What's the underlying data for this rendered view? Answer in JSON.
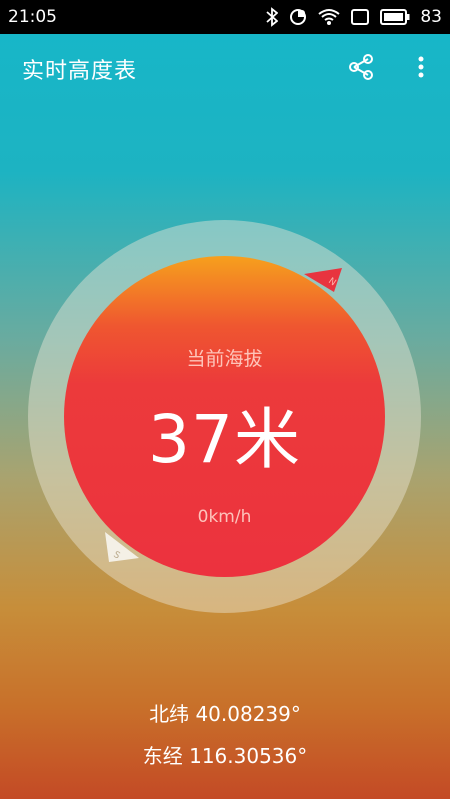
{
  "status_bar": {
    "time": "21:05",
    "battery": "83",
    "icons": [
      "bluetooth-icon",
      "data-sync-icon",
      "wifi-icon",
      "sim-icon",
      "battery-icon"
    ]
  },
  "app_bar": {
    "title": "实时高度表",
    "actions": [
      "share-icon",
      "more-vert-icon"
    ]
  },
  "gauge": {
    "caption": "当前海拔",
    "altitude": "37米",
    "speed": "0km/h",
    "north_label": "N",
    "south_label": "S"
  },
  "location": {
    "latitude": "北纬 40.08239°",
    "longitude": "东经 116.30536°"
  },
  "colors": {
    "dial_top": "#f6a01d",
    "dial_main": "#ec3a3b",
    "background_top": "#17b6c8",
    "background_bottom": "#c44a25"
  }
}
